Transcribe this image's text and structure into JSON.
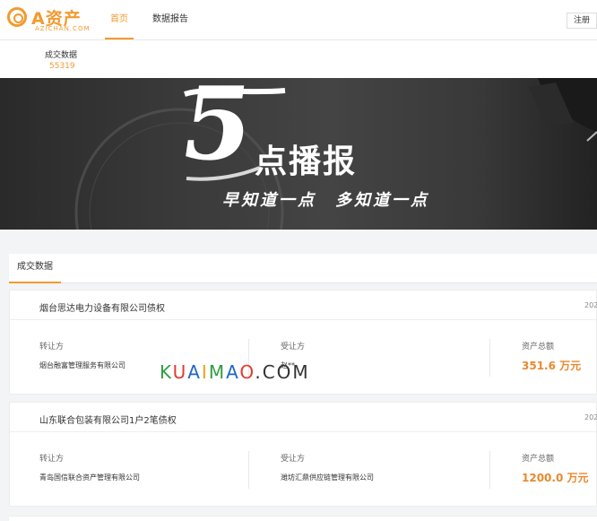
{
  "brand": {
    "name": "A资产",
    "sub": "AZICHAN.COM",
    "color": "#f39a2e"
  },
  "nav": {
    "items": [
      "首页",
      "数据报告"
    ],
    "active": "首页",
    "register": "注册"
  },
  "stats": {
    "label": "成交数据",
    "value": "55319"
  },
  "banner": {
    "number": "5",
    "title": "点播报",
    "slogan": "早知道一点　多知道一点"
  },
  "section": {
    "tab": "成交数据"
  },
  "columns": {
    "transferor": "转让方",
    "transferee": "受让方",
    "total": "资产总额"
  },
  "cards": [
    {
      "title": "烟台思达电力设备有限公司债权",
      "date": "202",
      "transferor": "烟台融富管理服务有限公司",
      "transferee": "赵**",
      "amount": "351.6 万元"
    },
    {
      "title": "山东联合包装有限公司1户2笔债权",
      "date": "202",
      "transferor": "青岛国信联合资产管理有限公司",
      "transferee": "潍坊汇鼎供应链管理有限公司",
      "amount": "1200.0 万元"
    }
  ],
  "watermark": {
    "letters": [
      "K",
      "U",
      "A",
      "I",
      "M",
      "A",
      "O",
      ".COM"
    ]
  }
}
